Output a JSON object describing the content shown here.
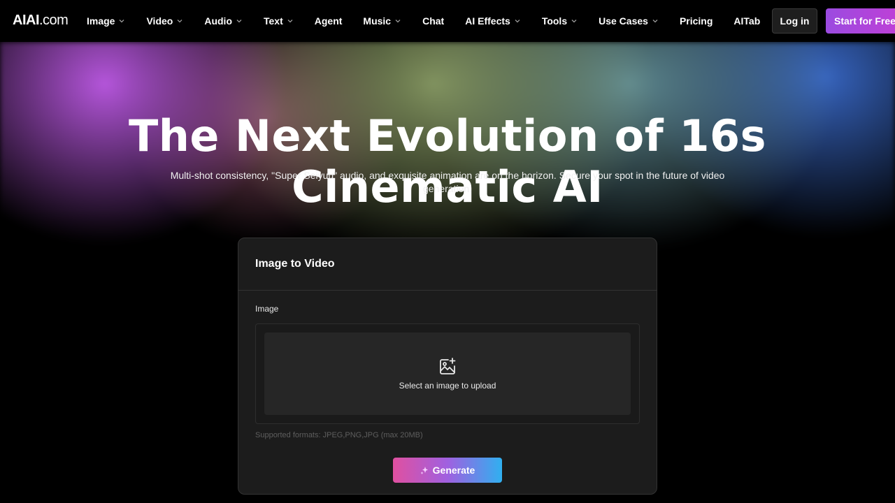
{
  "header": {
    "logo_strong": "AIAI",
    "logo_light": ".com",
    "nav": [
      {
        "label": "Image",
        "dropdown": true
      },
      {
        "label": "Video",
        "dropdown": true
      },
      {
        "label": "Audio",
        "dropdown": true
      },
      {
        "label": "Text",
        "dropdown": true
      },
      {
        "label": "Agent",
        "dropdown": false
      },
      {
        "label": "Music",
        "dropdown": true
      },
      {
        "label": "Chat",
        "dropdown": false
      },
      {
        "label": "AI Effects",
        "dropdown": true
      },
      {
        "label": "Tools",
        "dropdown": true
      },
      {
        "label": "Use Cases",
        "dropdown": true
      },
      {
        "label": "Pricing",
        "dropdown": false
      },
      {
        "label": "AITab",
        "dropdown": false
      }
    ],
    "login_label": "Log in",
    "start_label": "Start for Free"
  },
  "hero": {
    "title": "The Next Evolution of 16s Cinematic AI",
    "subtitle": "Multi-shot consistency, \"Super Seiyuu\" audio, and exquisite animation are on the horizon. Secure your spot in the future of video generation."
  },
  "card": {
    "title": "Image to Video",
    "field_label": "Image",
    "upload_text": "Select an image to upload",
    "formats": "Supported formats: JPEG,PNG,JPG (max 20MB)",
    "generate_label": "Generate"
  },
  "icons": {
    "chevron": "chevron-down-icon",
    "upload": "image-add-icon",
    "generate": "sparkle-icon"
  },
  "colors": {
    "start_button": "#9b4be0",
    "generate_gradient_start": "#e050a0",
    "generate_gradient_end": "#30b0f0",
    "card_bg": "#1c1c1c"
  }
}
